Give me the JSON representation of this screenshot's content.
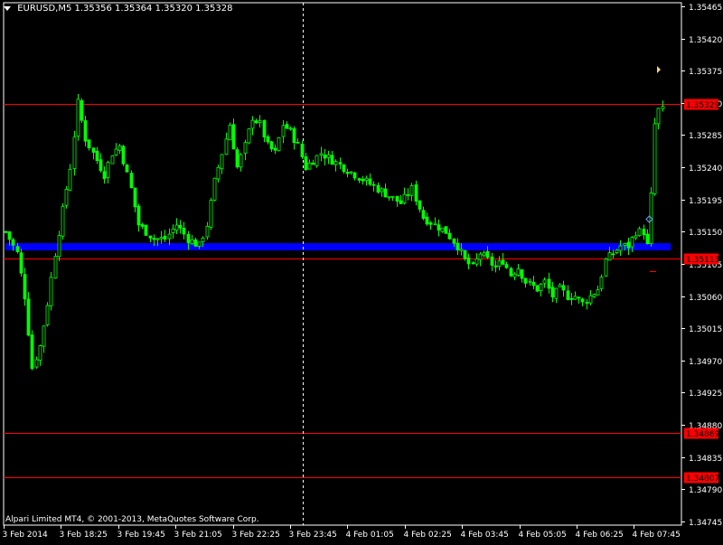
{
  "header": {
    "symbol": "EURUSD,M5",
    "open": "1.35356",
    "high": "1.35364",
    "low": "1.35320",
    "close": "1.35328"
  },
  "copyright": "Alpari Limited MT4, © 2001-2013, MetaQuotes Software Corp.",
  "colors": {
    "background": "#000000",
    "candle": "#00ff00",
    "axis": "#ffffff",
    "hline": "#ff0000",
    "support_band": "#0000ff",
    "vline": "#ffffff"
  },
  "chart_data": {
    "type": "candlestick",
    "title": "",
    "ylim": [
      1.34745,
      1.35465
    ],
    "y_ticks": [
      "1.35465",
      "1.35420",
      "1.35375",
      "1.35330",
      "1.35285",
      "1.35240",
      "1.35195",
      "1.35150",
      "1.35105",
      "1.35060",
      "1.35015",
      "1.34970",
      "1.34925",
      "1.34880",
      "1.34835",
      "1.34790",
      "1.34745"
    ],
    "x_ticks": [
      "3 Feb 2014",
      "3 Feb 18:25",
      "3 Feb 19:45",
      "3 Feb 21:05",
      "3 Feb 22:25",
      "3 Feb 23:45",
      "4 Feb 01:05",
      "4 Feb 02:25",
      "4 Feb 03:45",
      "4 Feb 05:05",
      "4 Feb 06:25",
      "4 Feb 07:45"
    ],
    "horizontal_lines": [
      {
        "price": 1.35329,
        "label": "1.35329",
        "color": "#ff0000"
      },
      {
        "price": 1.35113,
        "label": "1.35113",
        "color": "#ff0000"
      },
      {
        "price": 1.34869,
        "label": "1.34869",
        "color": "#ff0000"
      },
      {
        "price": 1.34807,
        "label": "1.34807",
        "color": "#ff0000"
      }
    ],
    "support_band": {
      "from": 1.35124,
      "to": 1.35134,
      "color": "#0000ff"
    },
    "vertical_line_time": "3 Feb 23:45",
    "close_path": [
      [
        0,
        1.3515
      ],
      [
        3,
        1.3512
      ],
      [
        5,
        1.3506
      ],
      [
        7,
        1.3496
      ],
      [
        9,
        1.3499
      ],
      [
        11,
        1.3505
      ],
      [
        13,
        1.3512
      ],
      [
        15,
        1.3518
      ],
      [
        17,
        1.3524
      ],
      [
        19,
        1.3533
      ],
      [
        21,
        1.3528
      ],
      [
        23,
        1.3526
      ],
      [
        26,
        1.3523
      ],
      [
        28,
        1.3526
      ],
      [
        30,
        1.3527
      ],
      [
        33,
        1.3521
      ],
      [
        35,
        1.3516
      ],
      [
        37,
        1.3515
      ],
      [
        39,
        1.3514
      ],
      [
        42,
        1.3514
      ],
      [
        45,
        1.3516
      ],
      [
        48,
        1.3514
      ],
      [
        51,
        1.3513
      ],
      [
        53,
        1.3516
      ],
      [
        55,
        1.3522
      ],
      [
        57,
        1.3526
      ],
      [
        59,
        1.353
      ],
      [
        61,
        1.3524
      ],
      [
        63,
        1.3527
      ],
      [
        65,
        1.3531
      ],
      [
        67,
        1.353
      ],
      [
        69,
        1.3527
      ],
      [
        71,
        1.3526
      ],
      [
        73,
        1.353
      ],
      [
        75,
        1.3529
      ],
      [
        77,
        1.3527
      ],
      [
        79,
        1.3524
      ],
      [
        81,
        1.3525
      ],
      [
        83,
        1.3526
      ],
      [
        86,
        1.3525
      ],
      [
        89,
        1.3524
      ],
      [
        92,
        1.3523
      ],
      [
        95,
        1.3522
      ],
      [
        98,
        1.3521
      ],
      [
        101,
        1.352
      ],
      [
        104,
        1.3519
      ],
      [
        107,
        1.3521
      ],
      [
        110,
        1.3517
      ],
      [
        113,
        1.3516
      ],
      [
        116,
        1.3515
      ],
      [
        119,
        1.3513
      ],
      [
        121,
        1.3511
      ],
      [
        123,
        1.351
      ],
      [
        125,
        1.3512
      ],
      [
        127,
        1.3511
      ],
      [
        129,
        1.351
      ],
      [
        131,
        1.3511
      ],
      [
        133,
        1.3509
      ],
      [
        135,
        1.351
      ],
      [
        137,
        1.3508
      ],
      [
        140,
        1.3507
      ],
      [
        142,
        1.3508
      ],
      [
        144,
        1.3506
      ],
      [
        146,
        1.3507
      ],
      [
        148,
        1.3506
      ],
      [
        150,
        1.3506
      ],
      [
        152,
        1.3505
      ],
      [
        154,
        1.3506
      ],
      [
        156,
        1.3507
      ],
      [
        158,
        1.3511
      ],
      [
        160,
        1.3512
      ],
      [
        162,
        1.3513
      ],
      [
        164,
        1.3513
      ],
      [
        166,
        1.3515
      ],
      [
        168,
        1.3515
      ],
      [
        169,
        1.3513
      ],
      [
        170,
        1.352
      ],
      [
        171,
        1.353
      ],
      [
        172,
        1.3532
      ]
    ],
    "last_price": 1.35328
  }
}
